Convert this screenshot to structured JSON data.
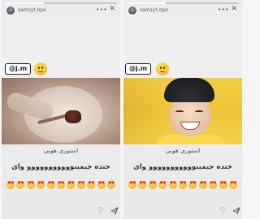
{
  "stories": [
    {
      "id": "left",
      "progress": 0.35,
      "username": "samsyt.opo",
      "time": "",
      "mention": "@j.m",
      "media_description": "",
      "caption_title": "استوری هوبی",
      "caption_main": "خنده جیمینووووووووووو وای",
      "emoji_count": 11,
      "emoji_name": "heart-eyes"
    },
    {
      "id": "right",
      "progress": 0.35,
      "username": "samsyt.opo",
      "time": "",
      "mention": "@j.m",
      "media_description": "",
      "caption_title": "استوری هوبی",
      "caption_main": "خنده جیمینووووووووووو وای",
      "emoji_count": 11,
      "emoji_name": "heart-eyes"
    }
  ],
  "colors": {
    "background": "#f4f5f6",
    "text": "#2f2f2f",
    "sticker_border": "#1b1b1b",
    "emoji_yellow": "#f7c22c",
    "heart_red": "#e0263a"
  },
  "icons": {
    "more": "more-horizontal-icon",
    "close": "close-icon",
    "like": "heart-outline-icon",
    "send": "paper-plane-icon"
  }
}
